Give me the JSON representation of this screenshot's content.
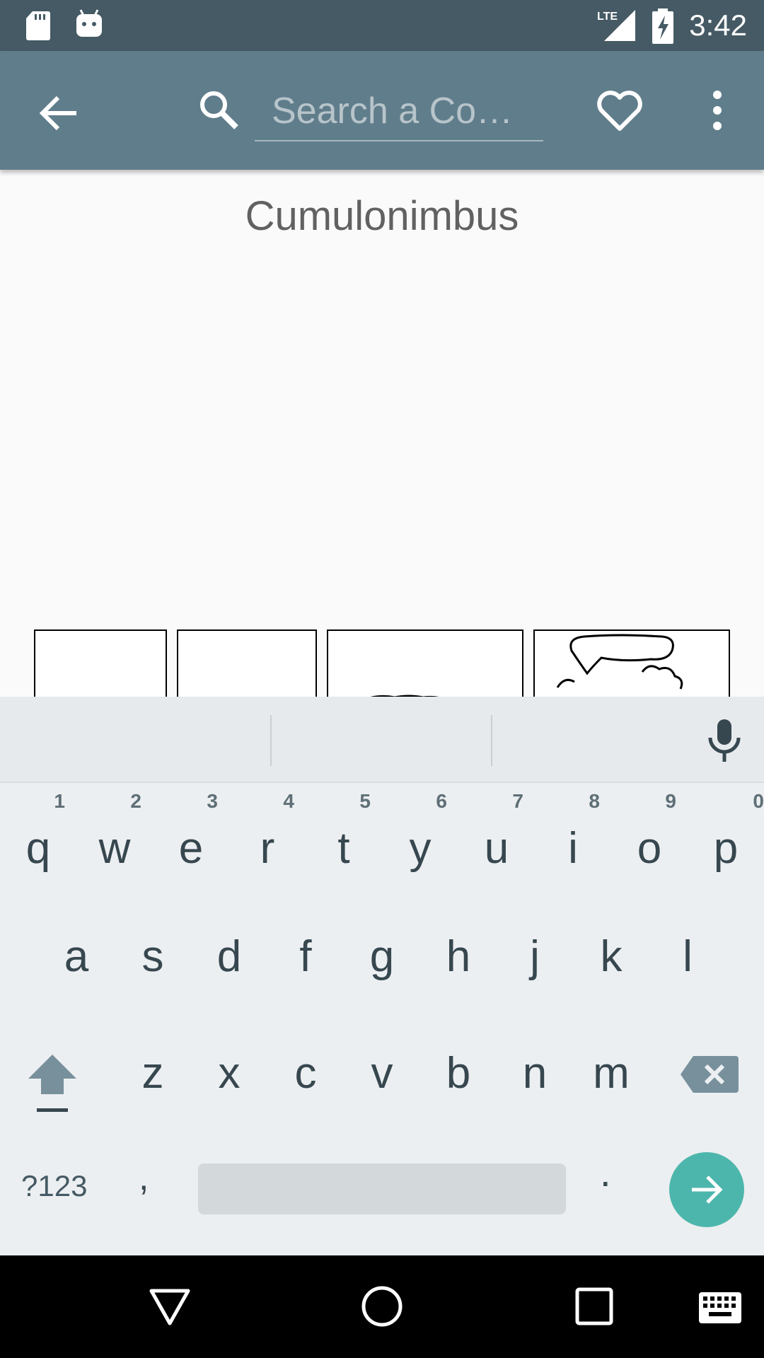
{
  "status_bar": {
    "time": "3:42",
    "network": "LTE",
    "icons": [
      "sd-card-icon",
      "android-icon",
      "lte-signal-icon",
      "battery-charging-icon"
    ]
  },
  "app_bar": {
    "back_icon": "arrow-left-icon",
    "search_icon": "search-icon",
    "search_placeholder": "Search a Co…",
    "search_value": "",
    "favorite_icon": "heart-outline-icon",
    "more_icon": "more-vert-icon"
  },
  "content": {
    "comic_title": "Cumulonimbus"
  },
  "keyboard": {
    "row1": [
      {
        "letter": "q",
        "hint": "1"
      },
      {
        "letter": "w",
        "hint": "2"
      },
      {
        "letter": "e",
        "hint": "3"
      },
      {
        "letter": "r",
        "hint": "4"
      },
      {
        "letter": "t",
        "hint": "5"
      },
      {
        "letter": "y",
        "hint": "6"
      },
      {
        "letter": "u",
        "hint": "7"
      },
      {
        "letter": "i",
        "hint": "8"
      },
      {
        "letter": "o",
        "hint": "9"
      },
      {
        "letter": "p",
        "hint": "0"
      }
    ],
    "row2": [
      "a",
      "s",
      "d",
      "f",
      "g",
      "h",
      "j",
      "k",
      "l"
    ],
    "row3": [
      "z",
      "x",
      "c",
      "v",
      "b",
      "n",
      "m"
    ],
    "symbols_label": "?123",
    "comma": ",",
    "period": ".",
    "accent_color": "#4db6ac"
  },
  "nav_bar": {
    "icons": [
      "back-triangle-icon",
      "home-circle-icon",
      "recents-square-icon",
      "keyboard-icon"
    ]
  }
}
